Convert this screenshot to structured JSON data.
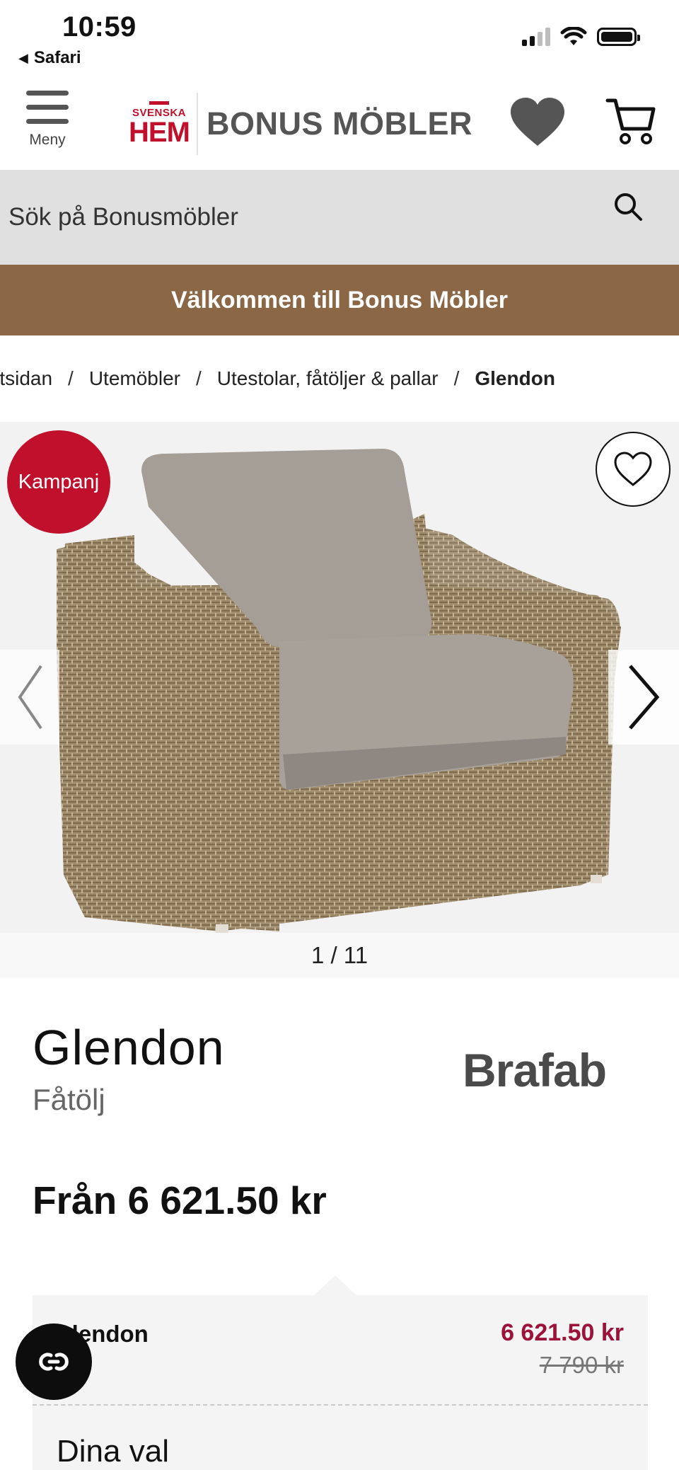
{
  "status_bar": {
    "time": "10:59",
    "back_app": "Safari"
  },
  "header": {
    "menu_label": "Meny",
    "logo_small_top": "SVENSKA",
    "logo_small_bottom": "HEM",
    "logo_text": "BONUS MÖBLER",
    "favorites_icon": "heart-icon",
    "cart_icon": "cart-icon"
  },
  "search": {
    "placeholder": "Sök på Bonusmöbler"
  },
  "banner": {
    "text": "Välkommen till Bonus Möbler"
  },
  "breadcrumb": {
    "items": [
      "rtsidan",
      "Utemöbler",
      "Utestolar, fåtöljer & pallar",
      "Glendon"
    ],
    "separator": "/"
  },
  "gallery": {
    "badge": "Kampanj",
    "counter": "1 / 11"
  },
  "product": {
    "name": "Glendon",
    "category": "Fåtölj",
    "brand": "Brafab",
    "price_from": "Från 6 621.50 kr"
  },
  "variant": {
    "name": "Glendon",
    "price": "6 621.50 kr",
    "old_price": "7 790 kr",
    "choices_label": "Dina val"
  },
  "colors": {
    "brand_red": "#c0102b",
    "banner_brown": "#8b6745",
    "sale_price": "#9c1238",
    "search_bg": "#e0e0e0"
  }
}
